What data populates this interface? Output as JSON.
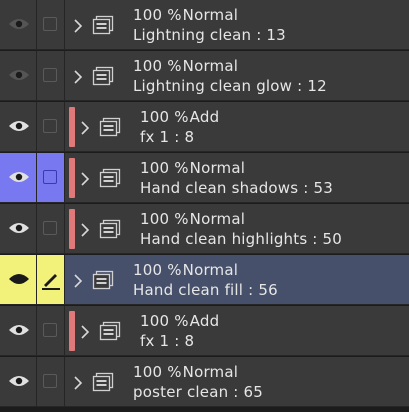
{
  "layers": [
    {
      "opacity": "100 %",
      "mode": "Normal",
      "name": "Lightning clean : 13",
      "clipped": false,
      "visible": false,
      "highlight": "none",
      "selected": false
    },
    {
      "opacity": "100 %",
      "mode": "Normal",
      "name": "Lightning clean glow : 12",
      "clipped": false,
      "visible": false,
      "highlight": "none",
      "selected": false
    },
    {
      "opacity": "100 %",
      "mode": "Add",
      "name": "fx 1 : 8",
      "clipped": true,
      "visible": true,
      "highlight": "none",
      "selected": false
    },
    {
      "opacity": "100 %",
      "mode": "Normal",
      "name": "Hand clean shadows : 53",
      "clipped": true,
      "visible": true,
      "highlight": "blue",
      "selected": false
    },
    {
      "opacity": "100 %",
      "mode": "Normal",
      "name": "Hand clean highlights : 50",
      "clipped": true,
      "visible": true,
      "highlight": "none",
      "selected": false
    },
    {
      "opacity": "100 %",
      "mode": "Normal",
      "name": "Hand clean fill : 56",
      "clipped": false,
      "visible": true,
      "highlight": "yellow",
      "selected": true
    },
    {
      "opacity": "100 %",
      "mode": "Add",
      "name": "fx 1 : 8",
      "clipped": true,
      "visible": true,
      "highlight": "none",
      "selected": false
    },
    {
      "opacity": "100 %",
      "mode": "Normal",
      "name": "poster clean : 65",
      "clipped": false,
      "visible": true,
      "highlight": "none",
      "selected": false
    }
  ],
  "colors": {
    "row_bg": "#3a3a3a",
    "selected_bg": "#46506a",
    "clip_bar": "#e07a7a",
    "highlight_blue": "#7878f0",
    "highlight_yellow": "#f2f27a"
  },
  "icons": {
    "visibility": "eye-icon",
    "lock": "checkbox",
    "edit": "pen-icon",
    "expand": "chevron-right-icon",
    "layer": "layer-folder-icon"
  }
}
